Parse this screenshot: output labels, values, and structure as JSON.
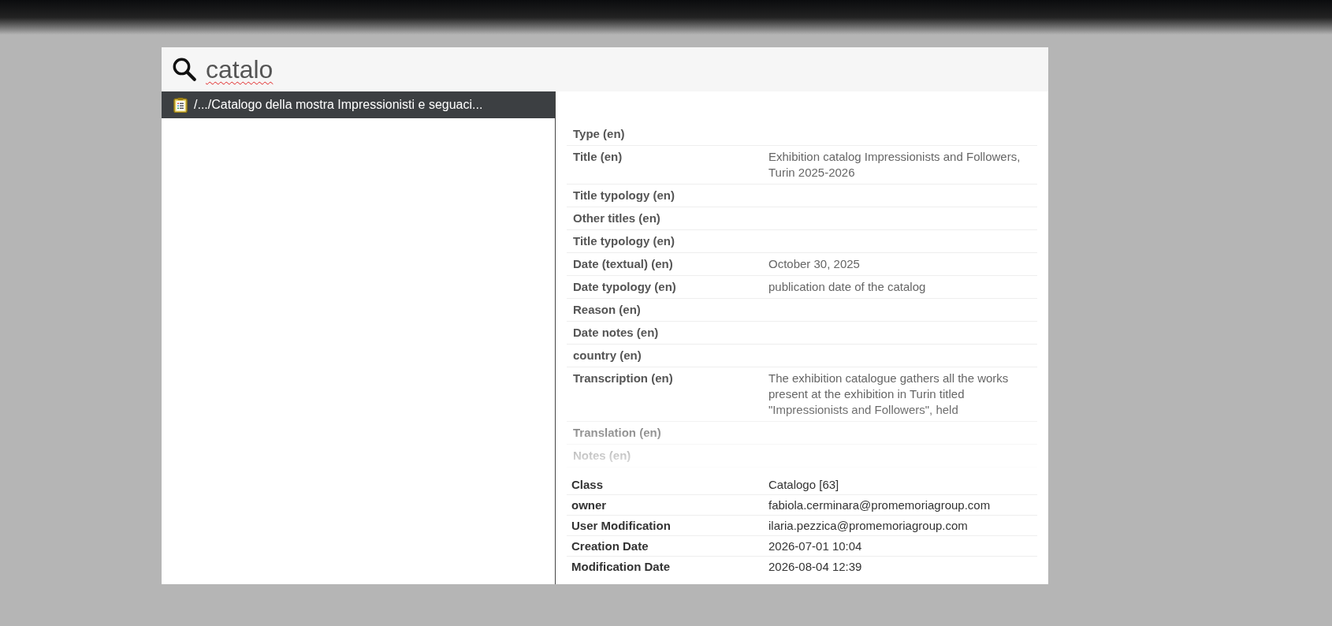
{
  "search": {
    "value": "catalo"
  },
  "results": [
    {
      "label": "/.../Catalogo della mostra Impressionisti e seguaci...",
      "selected": true
    }
  ],
  "details": {
    "fields": [
      {
        "label": "Type (en)"
      },
      {
        "label": "Title (en)",
        "value": "Exhibition catalog Impressionists and Followers, Turin 2025-2026"
      },
      {
        "label": "Title typology (en)"
      },
      {
        "label": "Other titles (en)"
      },
      {
        "label": "Title typology (en)"
      },
      {
        "label": "Date (textual) (en)",
        "value": "October 30, 2025"
      },
      {
        "label": "Date typology (en)",
        "value": "publication date of the catalog"
      },
      {
        "label": "Reason (en)"
      },
      {
        "label": "Date notes (en)"
      },
      {
        "label": "country (en)"
      },
      {
        "label": "Transcription (en)",
        "value": "The exhibition catalogue gathers all the works present at the exhibition in Turin titled \"Impressionists and Followers\", held"
      },
      {
        "label": "Translation (en)"
      },
      {
        "label": "Notes (en)"
      }
    ],
    "meta": [
      {
        "label": "Class",
        "value": "Catalogo [63]"
      },
      {
        "label": "owner",
        "value": "fabiola.cerminara@promemoriagroup.com"
      },
      {
        "label": "User Modification",
        "value": "ilaria.pezzica@promemoriagroup.com"
      },
      {
        "label": "Creation Date",
        "value": "2026-07-01 10:04"
      },
      {
        "label": "Modification Date",
        "value": "2026-08-04 12:39"
      }
    ]
  }
}
